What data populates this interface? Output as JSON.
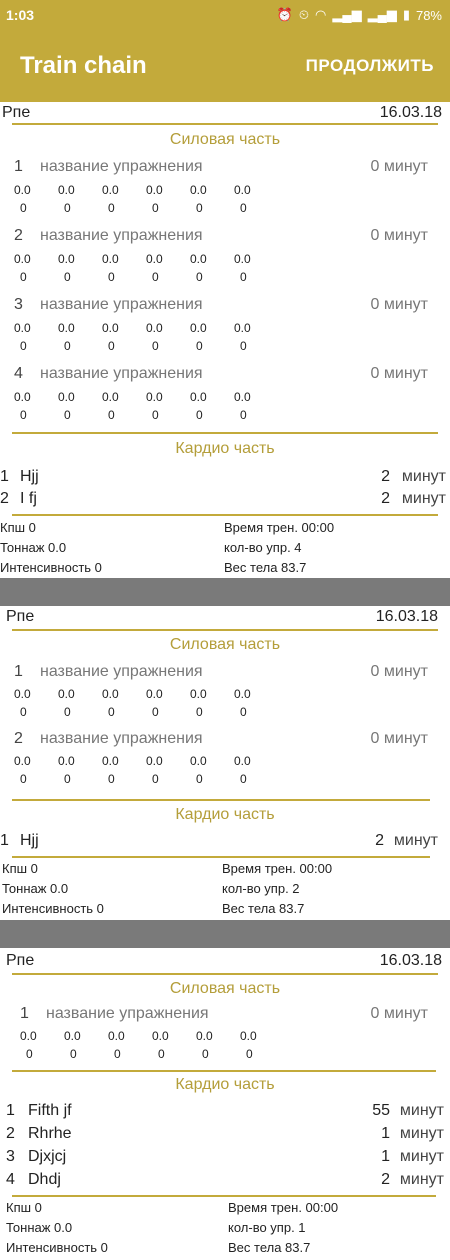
{
  "status": {
    "time": "1:03",
    "battery": "78%"
  },
  "app": {
    "title": "Train chain",
    "action": "ПРОДОЛЖИТЬ"
  },
  "cards": [
    {
      "name": "Рпе",
      "date": "16.03.18",
      "strength_label": "Силовая часть",
      "exercises": [
        {
          "num": "1",
          "name": "название упражнения",
          "minutes": "0 минут",
          "row1": [
            "0.0",
            "0.0",
            "0.0",
            "0.0",
            "0.0",
            "0.0"
          ],
          "row2": [
            "0",
            "0",
            "0",
            "0",
            "0",
            "0"
          ]
        },
        {
          "num": "2",
          "name": "название упражнения",
          "minutes": "0 минут",
          "row1": [
            "0.0",
            "0.0",
            "0.0",
            "0.0",
            "0.0",
            "0.0"
          ],
          "row2": [
            "0",
            "0",
            "0",
            "0",
            "0",
            "0"
          ]
        },
        {
          "num": "3",
          "name": "название упражнения",
          "minutes": "0 минут",
          "row1": [
            "0.0",
            "0.0",
            "0.0",
            "0.0",
            "0.0",
            "0.0"
          ],
          "row2": [
            "0",
            "0",
            "0",
            "0",
            "0",
            "0"
          ]
        },
        {
          "num": "4",
          "name": "название упражнения",
          "minutes": "0 минут",
          "row1": [
            "0.0",
            "0.0",
            "0.0",
            "0.0",
            "0.0",
            "0.0"
          ],
          "row2": [
            "0",
            "0",
            "0",
            "0",
            "0",
            "0"
          ]
        }
      ],
      "cardio_label": "Кардио часть",
      "cardio": [
        {
          "num": "1",
          "name": "Hjj",
          "value": "2",
          "unit": "минут"
        },
        {
          "num": "2",
          "name": "I fj",
          "value": "2",
          "unit": "минут"
        }
      ],
      "stats": {
        "ksh": "Кпш 0",
        "time": "Время трен. 00:00",
        "tonnage": "Тоннаж 0.0",
        "count": "кол-во упр. 4",
        "intensity": "Интенсивность 0",
        "weight": "Вес тела 83.7"
      }
    },
    {
      "name": "Рпе",
      "date": "16.03.18",
      "strength_label": "Силовая часть",
      "exercises": [
        {
          "num": "1",
          "name": "название упражнения",
          "minutes": "0 минут",
          "row1": [
            "0.0",
            "0.0",
            "0.0",
            "0.0",
            "0.0",
            "0.0"
          ],
          "row2": [
            "0",
            "0",
            "0",
            "0",
            "0",
            "0"
          ]
        },
        {
          "num": "2",
          "name": "название упражнения",
          "minutes": "0 минут",
          "row1": [
            "0.0",
            "0.0",
            "0.0",
            "0.0",
            "0.0",
            "0.0"
          ],
          "row2": [
            "0",
            "0",
            "0",
            "0",
            "0",
            "0"
          ]
        }
      ],
      "cardio_label": "Кардио часть",
      "cardio": [
        {
          "num": "1",
          "name": "Hjj",
          "value": "2",
          "unit": "минут"
        }
      ],
      "stats": {
        "ksh": "Кпш 0",
        "time": "Время трен. 00:00",
        "tonnage": "Тоннаж 0.0",
        "count": "кол-во упр. 2",
        "intensity": "Интенсивность 0",
        "weight": "Вес тела 83.7"
      }
    },
    {
      "name": "Рпе",
      "date": "16.03.18",
      "strength_label": "Силовая часть",
      "exercises": [
        {
          "num": "1",
          "name": "название упражнения",
          "minutes": "0 минут",
          "row1": [
            "0.0",
            "0.0",
            "0.0",
            "0.0",
            "0.0",
            "0.0"
          ],
          "row2": [
            "0",
            "0",
            "0",
            "0",
            "0",
            "0"
          ]
        }
      ],
      "cardio_label": "Кардио часть",
      "cardio": [
        {
          "num": "1",
          "name": "Fifth jf",
          "value": "55",
          "unit": "минут"
        },
        {
          "num": "2",
          "name": "Rhrhe",
          "value": "1",
          "unit": "минут"
        },
        {
          "num": "3",
          "name": "Djxjcj",
          "value": "1",
          "unit": "минут"
        },
        {
          "num": "4",
          "name": "Dhdj",
          "value": "2",
          "unit": "минут"
        }
      ],
      "stats": {
        "ksh": "Кпш 0",
        "time": "Время трен. 00:00",
        "tonnage": "Тоннаж 0.0",
        "count": "кол-во упр. 1",
        "intensity": "Интенсивность 0",
        "weight": "Вес тела 83.7"
      }
    }
  ]
}
